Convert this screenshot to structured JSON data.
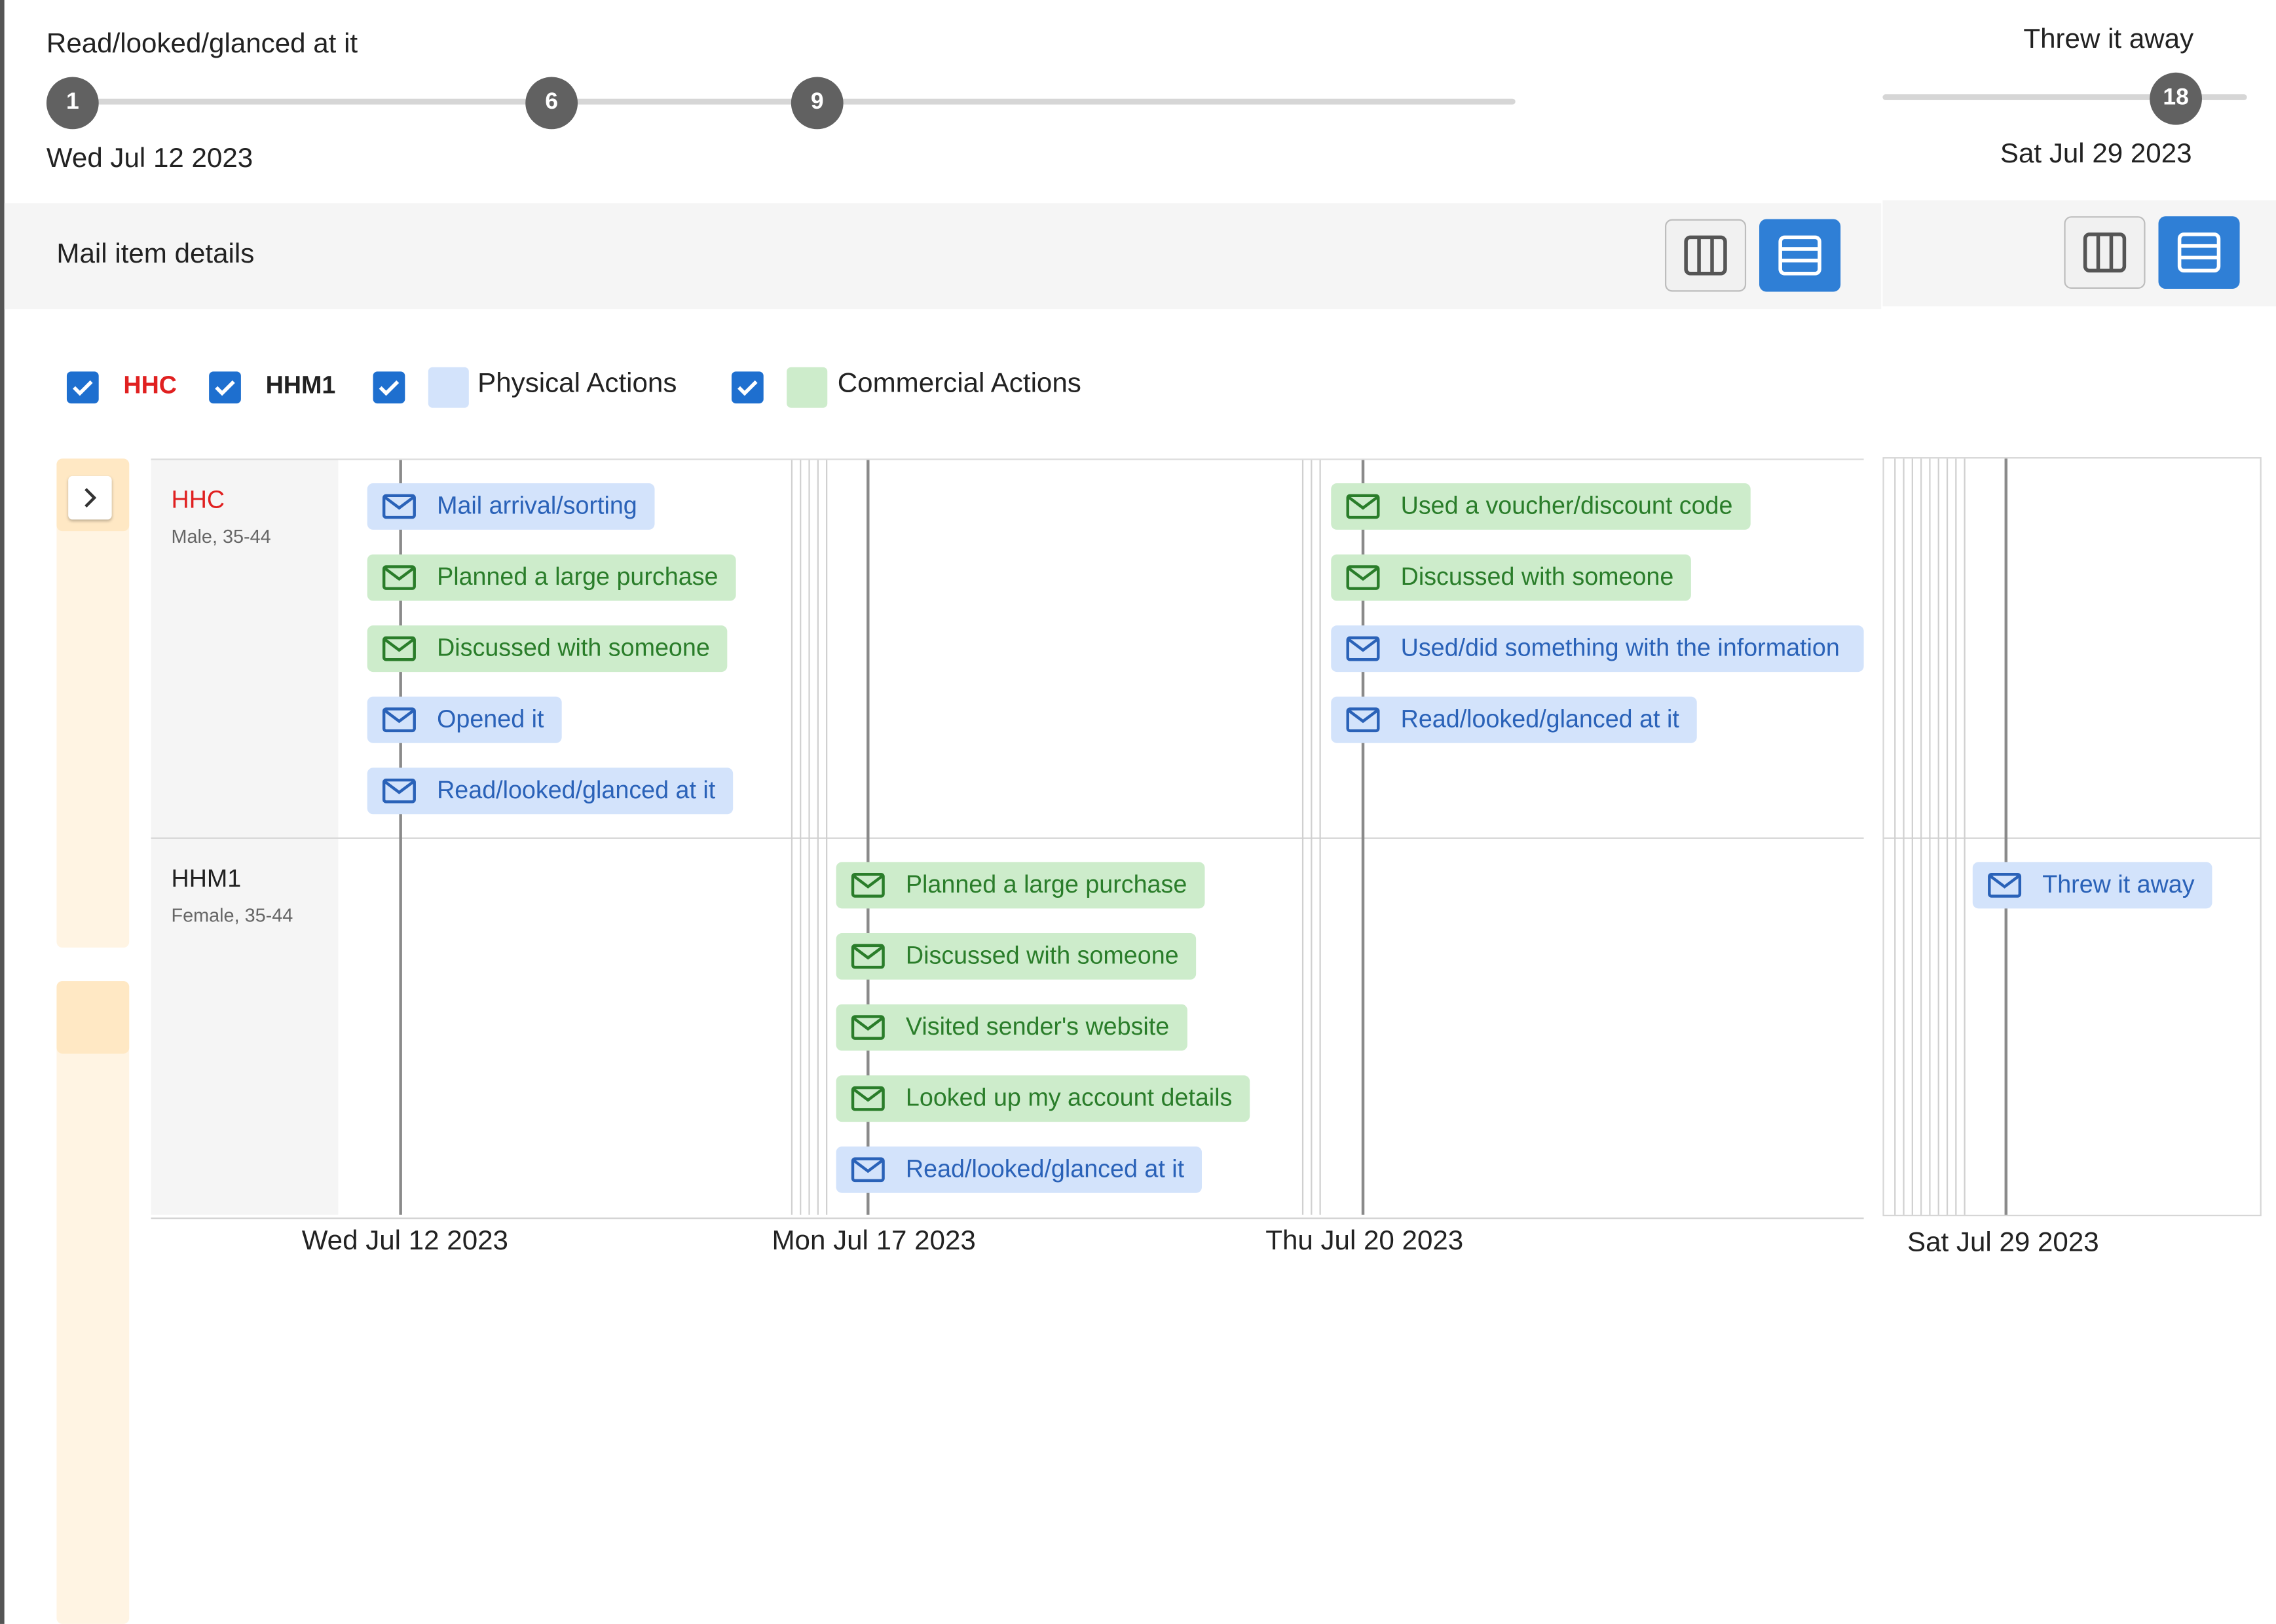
{
  "timeline_left": {
    "label": "Read/looked/glanced at it",
    "date": "Wed Jul 12 2023",
    "markers": [
      "1",
      "6",
      "9"
    ]
  },
  "timeline_right": {
    "label": "Threw it away",
    "date": "Sat Jul 29 2023",
    "marker": "18"
  },
  "toolbar": {
    "title": "Mail item details"
  },
  "legend": {
    "hhc": "HHC",
    "hhm1": "HHM1",
    "physical": "Physical Actions",
    "commercial": "Commercial Actions"
  },
  "lanes": {
    "hhc": {
      "name": "HHC",
      "sub": "Male, 35-44"
    },
    "hhm1": {
      "name": "HHM1",
      "sub": "Female, 35-44"
    }
  },
  "events": {
    "jul12_hhc": [
      {
        "label": "Mail arrival/sorting",
        "kind": "physical"
      },
      {
        "label": "Planned a large purchase",
        "kind": "commercial"
      },
      {
        "label": "Discussed with someone",
        "kind": "commercial"
      },
      {
        "label": "Opened it",
        "kind": "physical"
      },
      {
        "label": "Read/looked/glanced at it",
        "kind": "physical"
      }
    ],
    "jul17_hhm1": [
      {
        "label": "Planned a large purchase",
        "kind": "commercial"
      },
      {
        "label": "Discussed with someone",
        "kind": "commercial"
      },
      {
        "label": "Visited sender's website",
        "kind": "commercial"
      },
      {
        "label": "Looked up my account details",
        "kind": "commercial"
      },
      {
        "label": "Read/looked/glanced at it",
        "kind": "physical"
      }
    ],
    "jul20_hhc": [
      {
        "label": "Used a voucher/discount code",
        "kind": "commercial"
      },
      {
        "label": "Discussed with someone",
        "kind": "commercial"
      },
      {
        "label": "Used/did something with the information",
        "kind": "physical"
      },
      {
        "label": "Read/looked/glanced at it",
        "kind": "physical"
      }
    ],
    "jul29_hhm1": [
      {
        "label": "Threw it away",
        "kind": "physical"
      }
    ]
  },
  "axis": [
    "Wed Jul 12 2023",
    "Mon Jul 17 2023",
    "Thu Jul 20 2023",
    "Sat Jul 29 2023"
  ],
  "colors": {
    "physical_bg": "#d3e3fb",
    "physical_text": "#2a62b8",
    "commercial_bg": "#cdeccb",
    "commercial_text": "#2a7d2a",
    "hhc": "#e02020",
    "accent": "#2f7fd6"
  },
  "icons": {
    "event": "envelope-icon",
    "view_columns": "columns-view-icon",
    "view_rows": "rows-view-icon",
    "expand": "chevron-right-icon"
  }
}
